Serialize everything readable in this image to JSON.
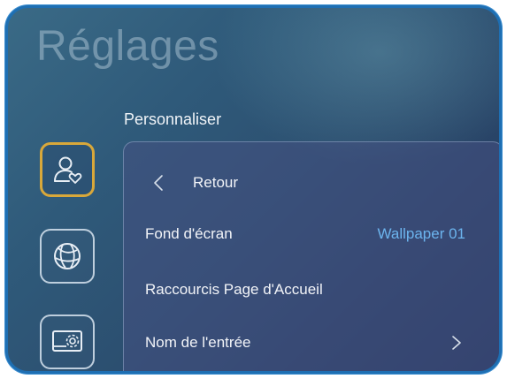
{
  "app": {
    "title": "Réglages"
  },
  "section": {
    "label": "Personnaliser"
  },
  "sidebar": {
    "items": [
      {
        "icon": "user-heart-icon",
        "selected": true
      },
      {
        "icon": "globe-icon",
        "selected": false
      },
      {
        "icon": "display-settings-icon",
        "selected": false
      }
    ]
  },
  "panel": {
    "back_label": "Retour",
    "rows": [
      {
        "label": "Fond d'écran",
        "value": "Wallpaper 01"
      },
      {
        "label": "Raccourcis Page d'Accueil"
      },
      {
        "label": "Nom de l'entrée"
      }
    ]
  },
  "colors": {
    "accent_selected": "#d9a83a",
    "value_text": "#6cb4ee",
    "frame": "#1e6fb3"
  }
}
